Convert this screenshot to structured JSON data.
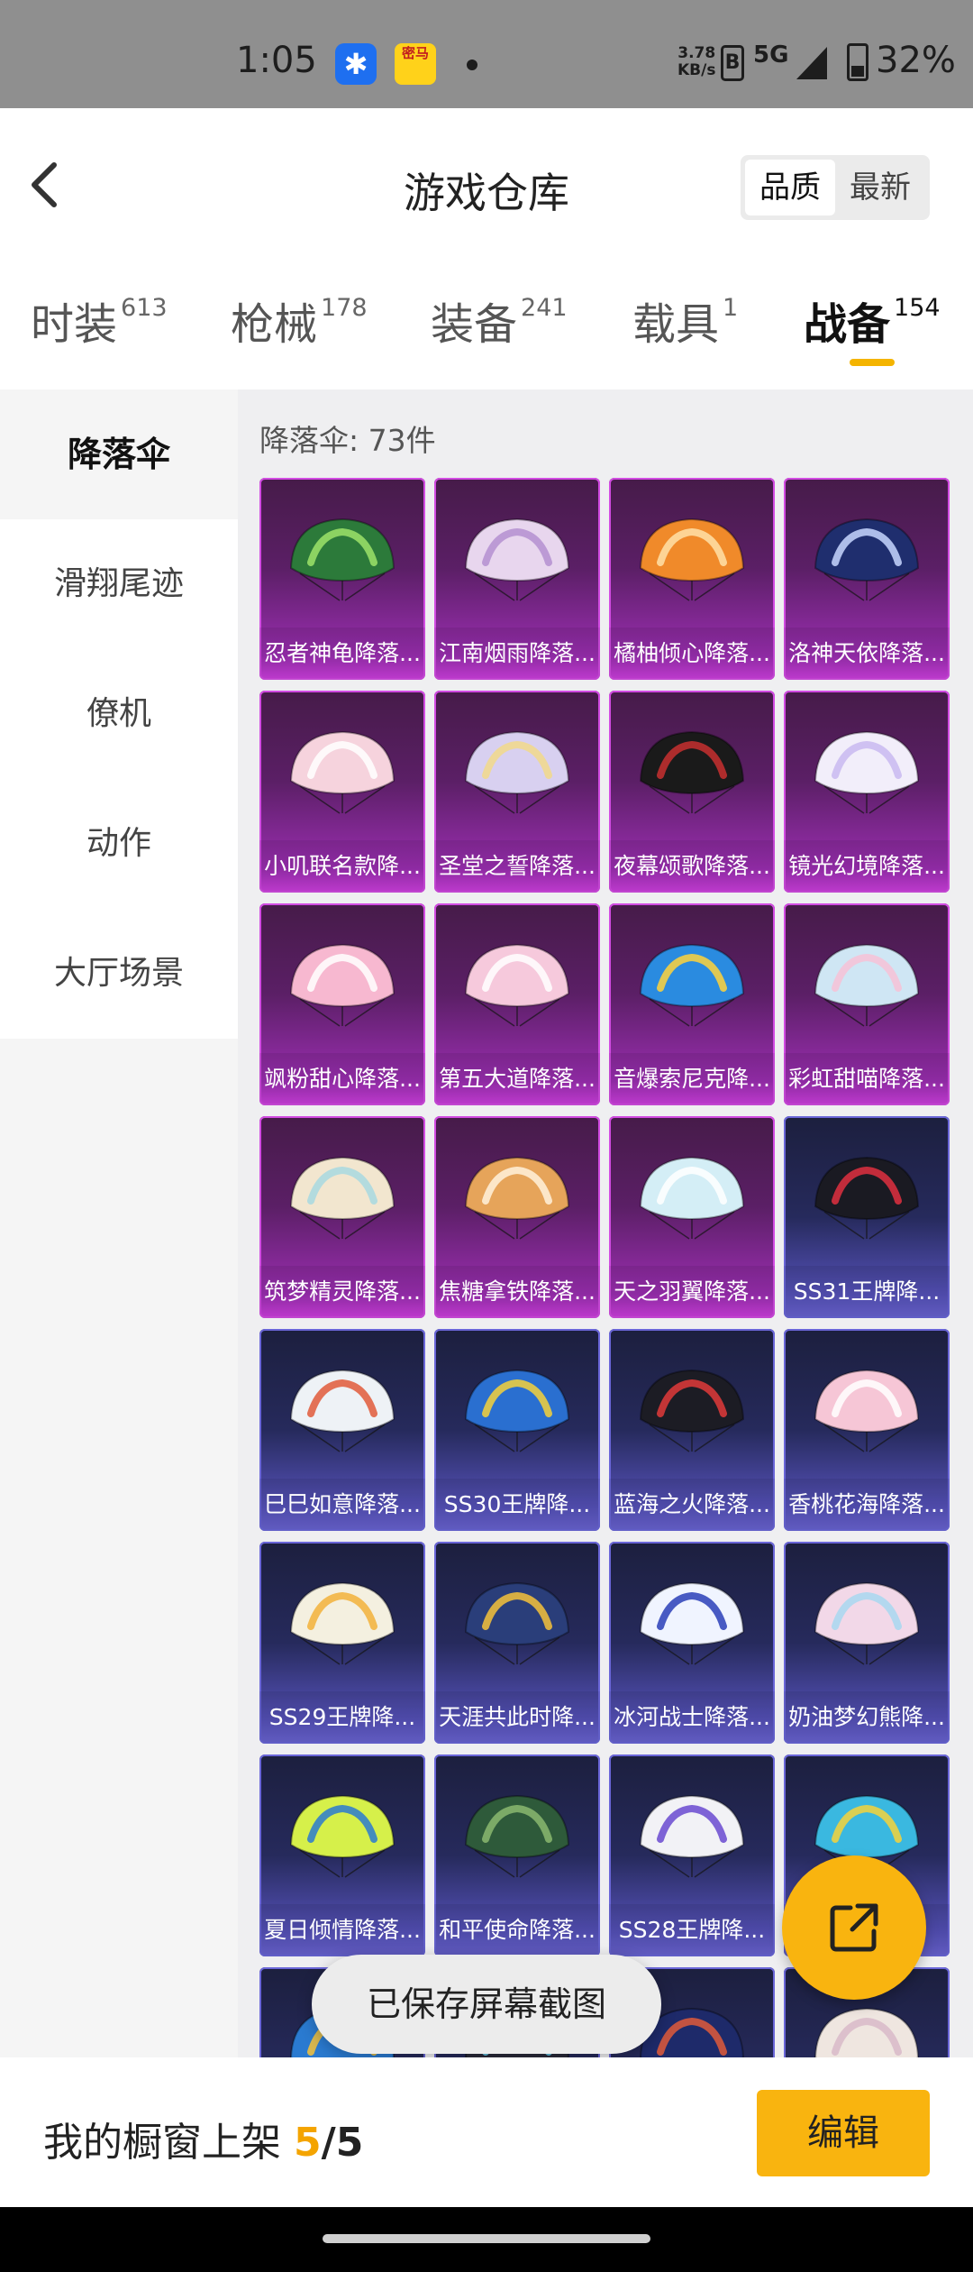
{
  "status_bar": {
    "time": "1:05",
    "app1_icon": "blue-star-app-icon",
    "app2_label": "密马",
    "network_speed": "3.78",
    "network_unit": "KB/s",
    "signal_type": "5G",
    "battery": "32%"
  },
  "header": {
    "title": "游戏仓库",
    "sort_options": [
      "品质",
      "最新"
    ],
    "active_sort": 0
  },
  "tabs": [
    {
      "label": "时装",
      "count": "613"
    },
    {
      "label": "枪械",
      "count": "178"
    },
    {
      "label": "装备",
      "count": "241"
    },
    {
      "label": "载具",
      "count": "1"
    },
    {
      "label": "战备",
      "count": "154"
    }
  ],
  "active_tab": 4,
  "sidenav": {
    "items": [
      "降落伞",
      "滑翔尾迹",
      "僚机",
      "动作",
      "大厅场景"
    ],
    "active": 0
  },
  "content": {
    "count_label": "降落伞: 73件",
    "items": [
      {
        "name": "忍者神龟降落...",
        "rarity": "purple",
        "color": "#2c7a3a",
        "accent": "#9ee36a"
      },
      {
        "name": "江南烟雨降落...",
        "rarity": "purple",
        "color": "#e8d6ee",
        "accent": "#b48fd0"
      },
      {
        "name": "橘柚倾心降落...",
        "rarity": "purple",
        "color": "#f08a2a",
        "accent": "#ffe0a8"
      },
      {
        "name": "洛神天依降落...",
        "rarity": "purple",
        "color": "#1f2e6e",
        "accent": "#c8d6ff"
      },
      {
        "name": "小叽联名款降...",
        "rarity": "purple",
        "color": "#f6d3dd",
        "accent": "#ffffff"
      },
      {
        "name": "圣堂之誓降落...",
        "rarity": "purple",
        "color": "#d8d0f0",
        "accent": "#f2d98a"
      },
      {
        "name": "夜幕颂歌降落...",
        "rarity": "purple",
        "color": "#1a1a1a",
        "accent": "#c83030"
      },
      {
        "name": "镜光幻境降落...",
        "rarity": "purple",
        "color": "#f2eefa",
        "accent": "#c9b8f0"
      },
      {
        "name": "飒粉甜心降落...",
        "rarity": "purple",
        "color": "#f7b8d0",
        "accent": "#ffffff"
      },
      {
        "name": "第五大道降落...",
        "rarity": "purple",
        "color": "#f6c9dc",
        "accent": "#ffffff"
      },
      {
        "name": "音爆索尼克降...",
        "rarity": "purple",
        "color": "#2a8be0",
        "accent": "#ffd23a"
      },
      {
        "name": "彩虹甜喵降落...",
        "rarity": "purple",
        "color": "#cfe6f4",
        "accent": "#f7c1d6"
      },
      {
        "name": "筑梦精灵降落...",
        "rarity": "purple",
        "color": "#f2e6cf",
        "accent": "#a8d8e0"
      },
      {
        "name": "焦糖拿铁降落...",
        "rarity": "purple",
        "color": "#e6a45a",
        "accent": "#fff2dc"
      },
      {
        "name": "天之羽翼降落...",
        "rarity": "purple",
        "color": "#d4eef6",
        "accent": "#ffffff"
      },
      {
        "name": "SS31王牌降...",
        "rarity": "blue",
        "color": "#1a1a22",
        "accent": "#e03040"
      },
      {
        "name": "巳巳如意降落...",
        "rarity": "blue",
        "color": "#eef2f6",
        "accent": "#e05a3a"
      },
      {
        "name": "SS30王牌降...",
        "rarity": "blue",
        "color": "#2a6fd0",
        "accent": "#f6d23a"
      },
      {
        "name": "蓝海之火降落...",
        "rarity": "blue",
        "color": "#1c1c24",
        "accent": "#e03a3a"
      },
      {
        "name": "香桃花海降落...",
        "rarity": "blue",
        "color": "#f6c6d6",
        "accent": "#ffffff"
      },
      {
        "name": "SS29王牌降...",
        "rarity": "blue",
        "color": "#f4f0e0",
        "accent": "#f2b23a"
      },
      {
        "name": "天涯共此时降...",
        "rarity": "blue",
        "color": "#2a3e7a",
        "accent": "#f6c23a"
      },
      {
        "name": "冰河战士降落...",
        "rarity": "blue",
        "color": "#f0f4ff",
        "accent": "#2a3eb8"
      },
      {
        "name": "奶油梦幻熊降...",
        "rarity": "blue",
        "color": "#f2d8e8",
        "accent": "#a8d8f0"
      },
      {
        "name": "夏日倾情降落...",
        "rarity": "blue",
        "color": "#d6f04a",
        "accent": "#2a7ad0"
      },
      {
        "name": "和平使命降落...",
        "rarity": "blue",
        "color": "#2e5a3a",
        "accent": "#8ab870"
      },
      {
        "name": "SS28王牌降...",
        "rarity": "blue",
        "color": "#f2f2f6",
        "accent": "#6a4ad0"
      },
      {
        "name": "",
        "rarity": "blue",
        "color": "#3ab8e0",
        "accent": "#f6d23a"
      },
      {
        "name": "",
        "rarity": "blue",
        "color": "#2a7ad0",
        "accent": "#f6c23a"
      },
      {
        "name": "",
        "rarity": "blue",
        "color": "#2a2a3a",
        "accent": "#6ad0f0"
      },
      {
        "name": "",
        "rarity": "blue",
        "color": "#1e2a6a",
        "accent": "#e05a3a"
      },
      {
        "name": "",
        "rarity": "blue",
        "color": "#efe6e0",
        "accent": "#d8b8c8"
      }
    ]
  },
  "toast": "已保存屏幕截图",
  "fab_icon": "share-external-icon",
  "bottom_bar": {
    "label": "我的橱窗上架 ",
    "current": "5",
    "total": "/5",
    "edit_label": "编辑"
  }
}
